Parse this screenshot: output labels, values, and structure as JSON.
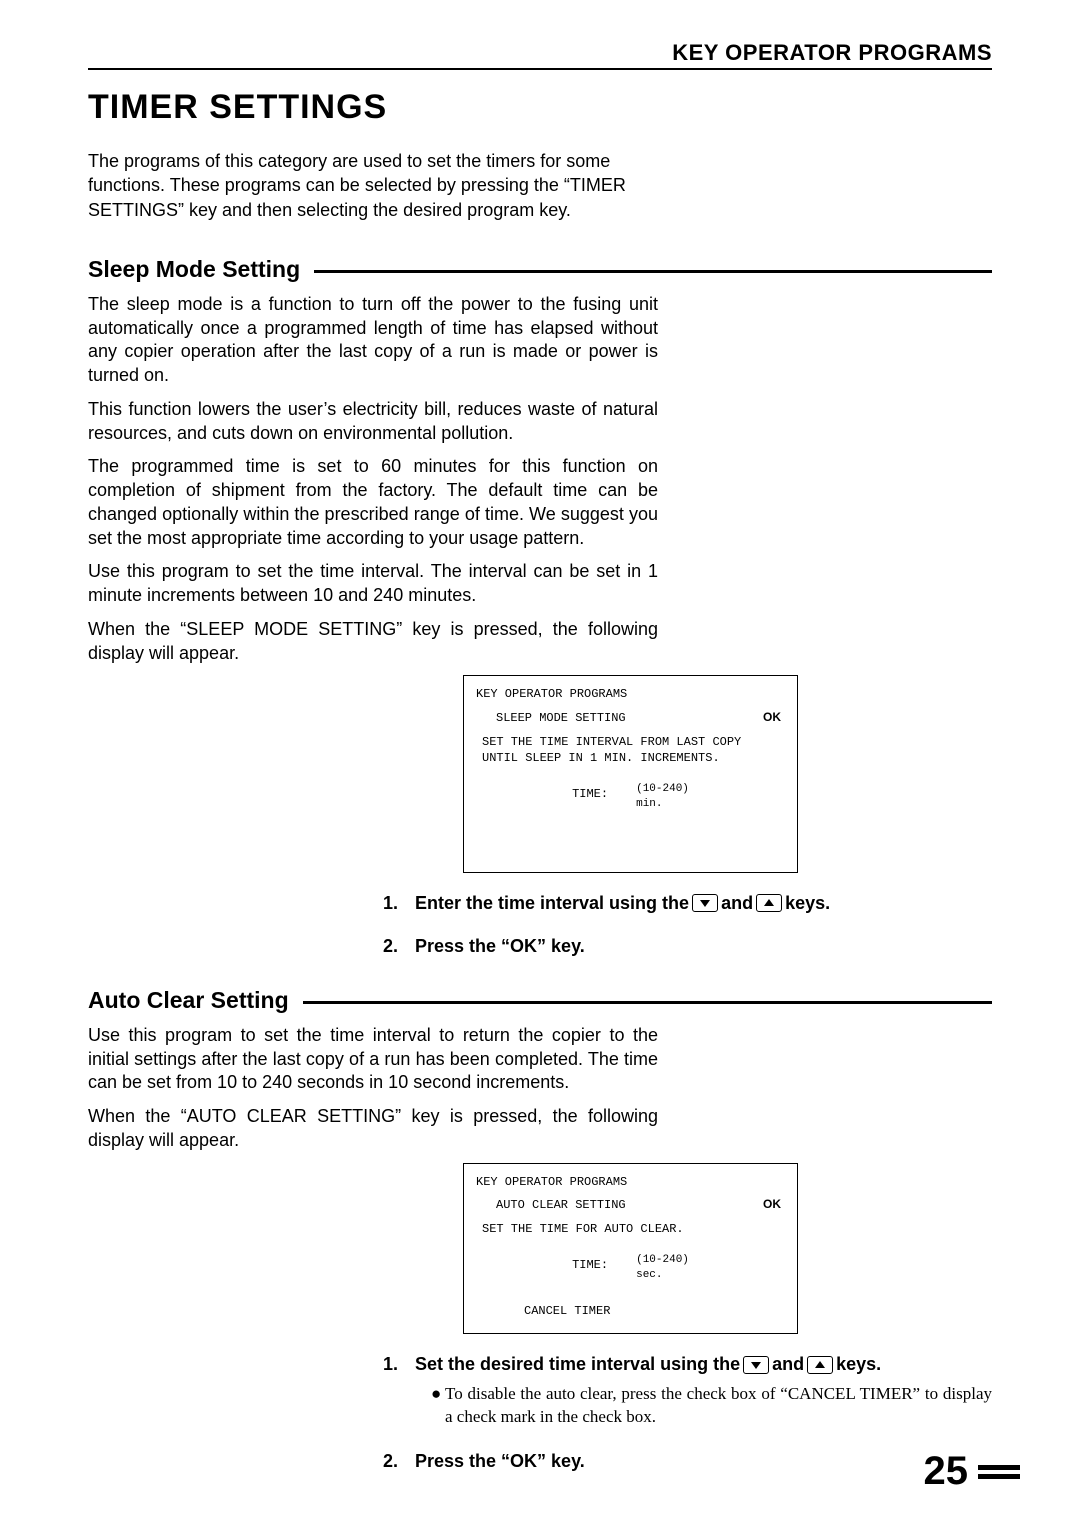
{
  "header": {
    "title": "KEY OPERATOR PROGRAMS"
  },
  "title": "TIMER SETTINGS",
  "intro": "The programs of this category are used to set the timers for some functions. These programs can be selected by pressing the “TIMER SETTINGS” key and then selecting the desired program key.",
  "sleep": {
    "heading": "Sleep Mode Setting",
    "p1": "The sleep mode is a function to turn off the power to the fusing unit automatically once a programmed length of time has elapsed without any copier operation after the last copy of a run is made or power is turned on.",
    "p2": "This function lowers the user’s electricity bill, reduces waste of natural resources, and cuts down on environmental pollution.",
    "p3": "The programmed time is set to 60 minutes for this function on completion of shipment from the factory. The default time can be changed optionally within the prescribed range of time. We suggest you set the most appropriate time according to your usage pattern.",
    "p4": "Use this program to set the time interval. The interval can be set in 1 minute increments between 10 and 240 minutes.",
    "p5": "When the “SLEEP MODE SETTING” key is pressed, the following display will appear.",
    "panel": {
      "top": "KEY OPERATOR PROGRAMS",
      "title": "SLEEP MODE SETTING",
      "ok": "OK",
      "msg1": "SET THE TIME INTERVAL FROM LAST COPY",
      "msg2": "UNTIL SLEEP IN 1 MIN. INCREMENTS.",
      "time_label": "TIME:",
      "range": "(10-240)",
      "unit": "min."
    },
    "step1a": "Enter the time interval using the ",
    "step1b": " and ",
    "step1c": " keys.",
    "step2": "Press the “OK” key."
  },
  "auto": {
    "heading": "Auto Clear Setting",
    "p1": "Use this program to set the time interval to return the copier to the initial settings after the last copy of a run has been completed. The time can be set from 10 to 240 seconds in 10 second increments.",
    "p2": "When the “AUTO CLEAR SETTING” key is pressed, the following display will appear.",
    "panel": {
      "top": "KEY OPERATOR PROGRAMS",
      "title": "AUTO CLEAR SETTING",
      "ok": "OK",
      "msg1": "SET THE TIME FOR AUTO CLEAR.",
      "time_label": "TIME:",
      "range": "(10-240)",
      "unit": "sec.",
      "cancel": "CANCEL TIMER"
    },
    "step1a": "Set the desired time interval using the ",
    "step1b": " and ",
    "step1c": " keys.",
    "bullet": "To disable the auto clear, press the check box of “CANCEL TIMER” to display a check mark in the check box.",
    "step2": "Press the “OK” key."
  },
  "page": "25"
}
